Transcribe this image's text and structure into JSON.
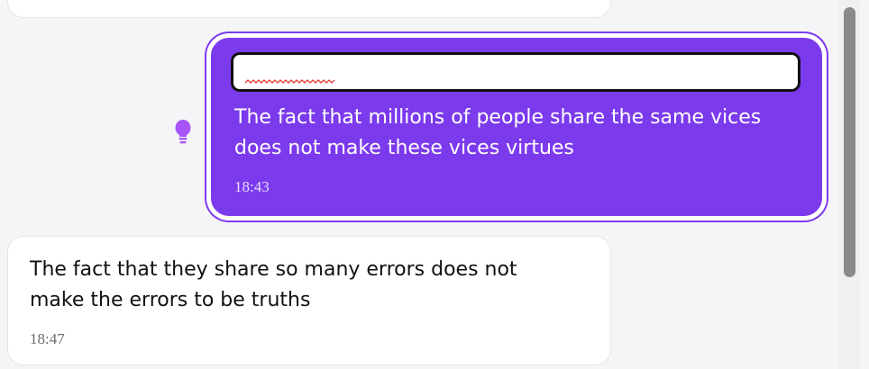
{
  "messages": [
    {
      "direction": "incoming",
      "text": "",
      "time": ""
    },
    {
      "direction": "outgoing",
      "edit_value": "",
      "text": "The fact that millions of people share the same vices does not make these vices virtues",
      "time": "18:43",
      "side_icon": "lightbulb-icon"
    },
    {
      "direction": "incoming",
      "text": "The fact that they share so many errors does not make the errors to be truths",
      "time": "18:47"
    }
  ],
  "colors": {
    "accent": "#7c3aed",
    "bubble_in": "#ffffff",
    "background": "#f5f5f7",
    "spellcheck": "#e53935"
  }
}
